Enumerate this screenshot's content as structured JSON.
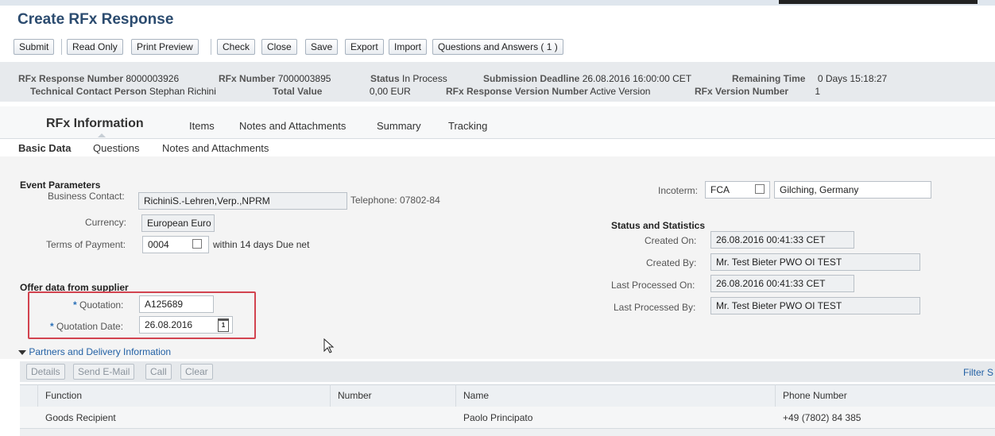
{
  "page": {
    "title": "Create RFx Response"
  },
  "toolbar": {
    "submit": "Submit",
    "read_only": "Read Only",
    "print_preview": "Print Preview",
    "check": "Check",
    "close": "Close",
    "save": "Save",
    "export": "Export",
    "import": "Import",
    "qa": "Questions and Answers ( 1 )"
  },
  "header": {
    "response_number_label": "RFx Response Number",
    "response_number": "8000003926",
    "rfx_number_label": "RFx Number",
    "rfx_number": "7000003895",
    "status_label": "Status",
    "status": "In Process",
    "deadline_label": "Submission Deadline",
    "deadline": "26.08.2016 16:00:00 CET",
    "remaining_label": "Remaining Time",
    "remaining": "0 Days 15:18:27",
    "tech_contact_label": "Technical Contact Person",
    "tech_contact": "Stephan Richini",
    "total_value_label": "Total Value",
    "total_value": "0,00 EUR",
    "resp_version_label": "RFx Response Version Number",
    "resp_version": "Active Version",
    "rfx_version_label": "RFx Version Number",
    "rfx_version": "1"
  },
  "tabs": {
    "rfx_information": "RFx Information",
    "items": "Items",
    "notes": "Notes and Attachments",
    "summary": "Summary",
    "tracking": "Tracking"
  },
  "subtabs": {
    "basic_data": "Basic Data",
    "questions": "Questions",
    "notes": "Notes and Attachments"
  },
  "event": {
    "section": "Event Parameters",
    "business_contact_label": "Business Contact:",
    "business_contact": "RichiniS.-Lehren,Verp.,NPRM",
    "telephone": "Telephone: 07802-84",
    "currency_label": "Currency:",
    "currency": "European Euro",
    "terms_label": "Terms of Payment:",
    "terms_code": "0004",
    "terms_text": "within 14 days Due net",
    "incoterm_label": "Incoterm:",
    "incoterm_code": "FCA",
    "incoterm_location": "Gilching, Germany"
  },
  "stats": {
    "section": "Status and Statistics",
    "created_on_label": "Created On:",
    "created_on": "26.08.2016 00:41:33 CET",
    "created_by_label": "Created By:",
    "created_by": "Mr. Test Bieter PWO OI TEST",
    "last_on_label": "Last Processed On:",
    "last_on": "26.08.2016 00:41:33 CET",
    "last_by_label": "Last Processed By:",
    "last_by": "Mr. Test Bieter PWO OI TEST"
  },
  "offer": {
    "section": "Offer data from supplier",
    "required_mark": "*",
    "quotation_label": "Quotation:",
    "quotation": "A125689",
    "quotation_date_label": "Quotation Date:",
    "quotation_date": "26.08.2016",
    "calendar_day": "1"
  },
  "partners": {
    "toggle": "Partners and Delivery Information",
    "details": "Details",
    "send_email": "Send E-Mail",
    "call": "Call",
    "clear": "Clear",
    "filter": "Filter S",
    "columns": [
      "Function",
      "Number",
      "Name",
      "Phone Number"
    ],
    "rows": [
      {
        "function": "Goods Recipient",
        "number": "",
        "name": "Paolo Principato",
        "phone": "+49 (7802) 84 385"
      }
    ]
  },
  "colors": {
    "title": "#2b4b6f",
    "required": "#2a70b8",
    "highlight_box": "#d2434f",
    "link": "#2361a5"
  }
}
